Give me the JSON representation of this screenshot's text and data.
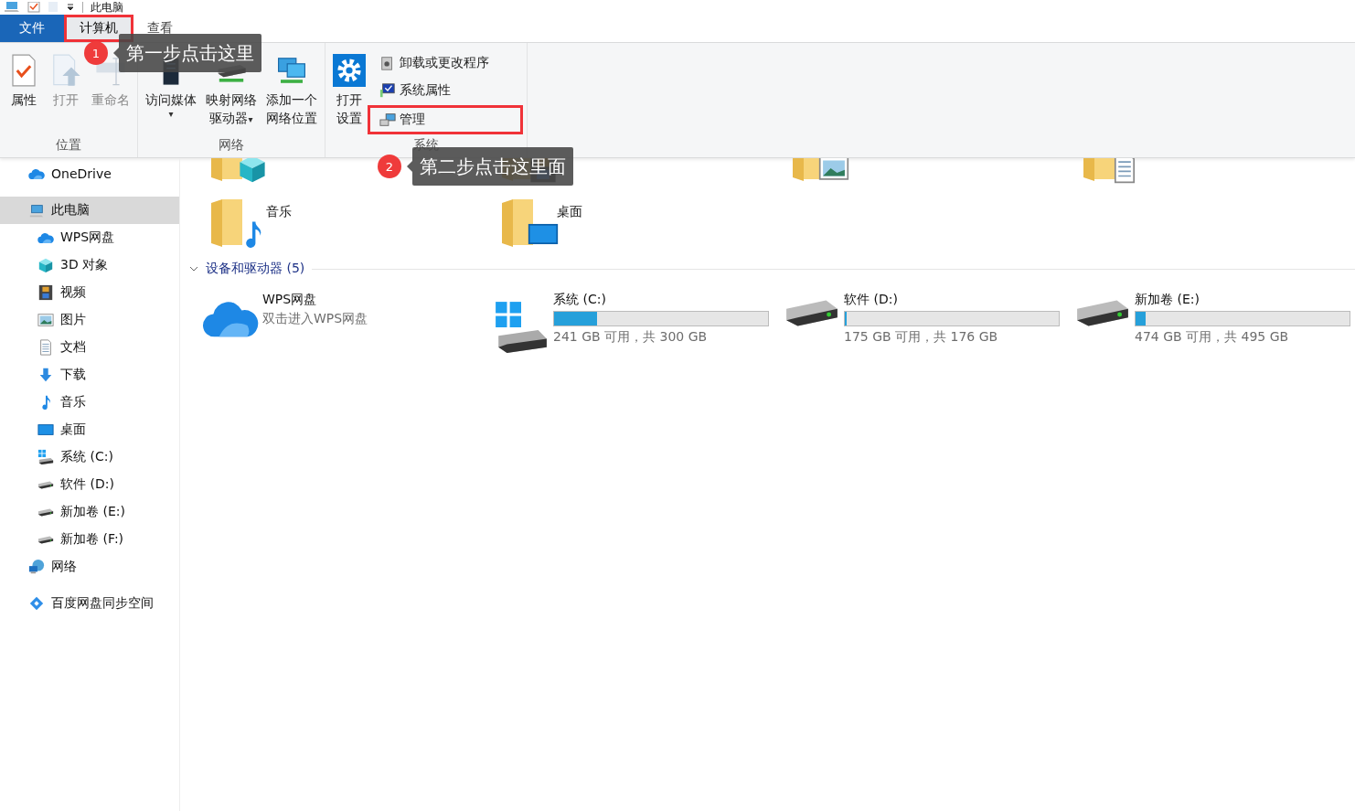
{
  "title_bar": {
    "title": "此电脑"
  },
  "tabs": [
    {
      "label": "文件",
      "kind": "file",
      "selected": false,
      "highlighted": false
    },
    {
      "label": "计算机",
      "kind": "tab",
      "selected": true,
      "highlighted": true
    },
    {
      "label": "查看",
      "kind": "tab",
      "selected": false,
      "highlighted": false
    }
  ],
  "ribbon": {
    "groups": [
      {
        "label": "位置",
        "buttons": [
          {
            "lines": [
              "属性"
            ],
            "kind": "properties",
            "disabled": false
          },
          {
            "lines": [
              "打开"
            ],
            "kind": "open",
            "disabled": true
          },
          {
            "lines": [
              "重命名"
            ],
            "kind": "rename",
            "disabled": true
          }
        ]
      },
      {
        "label": "网络",
        "buttons": [
          {
            "lines": [
              "访问媒体"
            ],
            "kind": "media",
            "disabled": false,
            "caret": "▾"
          },
          {
            "lines": [
              "映射网络",
              "驱动器"
            ],
            "kind": "mapdrive",
            "disabled": false,
            "caret": "▾"
          },
          {
            "lines": [
              "添加一个",
              "网络位置"
            ],
            "kind": "netlocation",
            "disabled": false
          }
        ]
      },
      {
        "label": "系统",
        "buttons": [
          {
            "lines": [
              "打开",
              "设置"
            ],
            "kind": "settings",
            "disabled": false
          }
        ],
        "items": [
          {
            "label": "卸载或更改程序",
            "kind": "uninstall",
            "highlighted": false
          },
          {
            "label": "系统属性",
            "kind": "sysprops",
            "highlighted": false
          },
          {
            "label": "管理",
            "kind": "manage",
            "highlighted": true
          }
        ]
      }
    ]
  },
  "annotations": [
    {
      "number": "1",
      "text": "第一步点击这里"
    },
    {
      "number": "2",
      "text": "第二步点击这里面"
    }
  ],
  "sidebar": {
    "items": [
      {
        "label": "OneDrive",
        "kind": "onedrive",
        "selected": false
      },
      {
        "label": "此电脑",
        "kind": "pc",
        "selected": true,
        "children": [
          {
            "label": "WPS网盘",
            "kind": "cloud",
            "selected": false
          },
          {
            "label": "3D 对象",
            "kind": "cube",
            "selected": false
          },
          {
            "label": "视频",
            "kind": "video",
            "selected": false
          },
          {
            "label": "图片",
            "kind": "pictures",
            "selected": false
          },
          {
            "label": "文档",
            "kind": "documents",
            "selected": false
          },
          {
            "label": "下载",
            "kind": "downloads",
            "selected": false
          },
          {
            "label": "音乐",
            "kind": "music",
            "selected": false
          },
          {
            "label": "桌面",
            "kind": "desktop",
            "selected": false
          },
          {
            "label": "系统 (C:)",
            "kind": "system",
            "selected": false
          },
          {
            "label": "软件 (D:)",
            "kind": "drive",
            "selected": false
          },
          {
            "label": "新加卷 (E:)",
            "kind": "drive",
            "selected": false
          },
          {
            "label": "新加卷 (F:)",
            "kind": "drive",
            "selected": false
          }
        ]
      },
      {
        "label": "网络",
        "kind": "network",
        "selected": false
      },
      {
        "label": "百度网盘同步空间",
        "kind": "baidu",
        "selected": false
      }
    ]
  },
  "folders_partial": [
    {
      "kind": "cube"
    },
    {
      "kind": "video"
    },
    {
      "kind": "pictures"
    },
    {
      "kind": "documents"
    }
  ],
  "folders": [
    {
      "name": "音乐",
      "kind": "music"
    },
    {
      "name": "桌面",
      "kind": "desktop"
    }
  ],
  "devices_group": {
    "label": "设备和驱动器 (5)",
    "expanded": true
  },
  "devices": [
    {
      "name": "WPS网盘",
      "kind": "cloud",
      "subtitle": "双击进入WPS网盘"
    },
    {
      "name": "系统 (C:)",
      "kind": "system",
      "level": 0.2,
      "reading": "241 GB 可用，共 300 GB"
    },
    {
      "name": "软件 (D:)",
      "kind": "drive",
      "level": 0.01,
      "reading": "175 GB 可用，共 176 GB"
    },
    {
      "name": "新加卷 (E:)",
      "kind": "drive",
      "level": 0.045,
      "reading": "474 GB 可用，共 495 GB"
    }
  ]
}
